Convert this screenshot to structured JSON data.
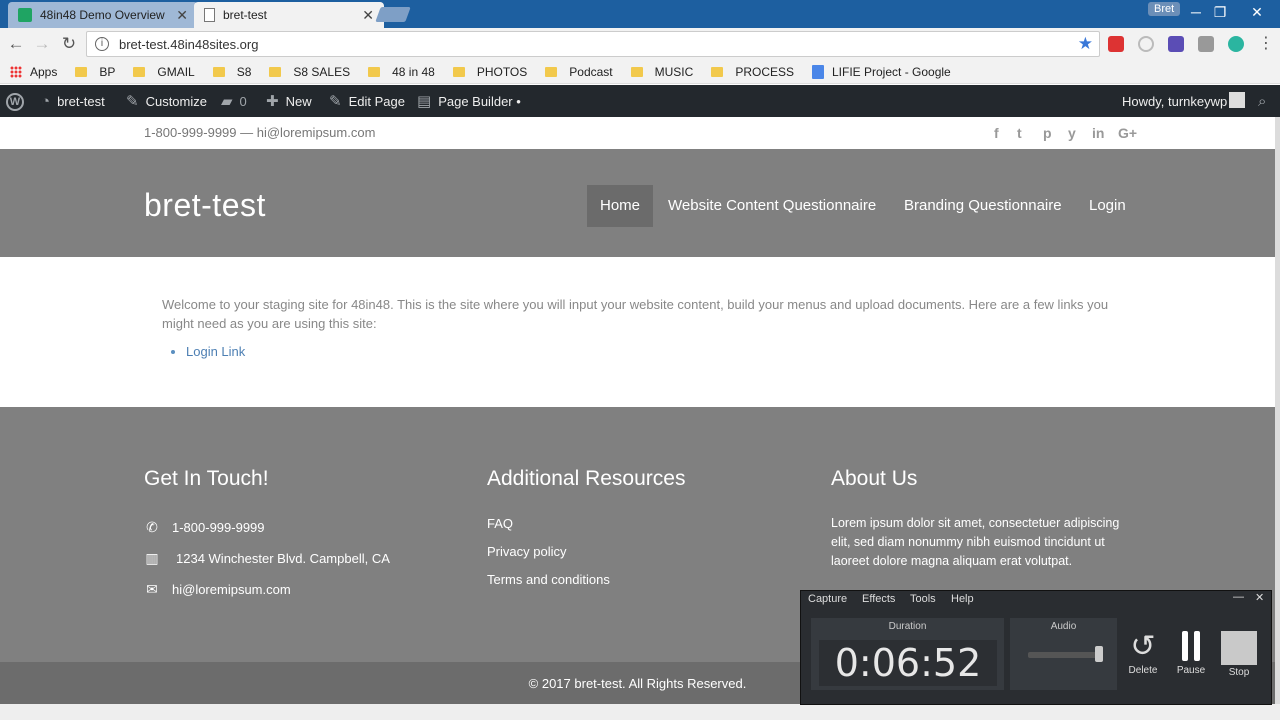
{
  "browser": {
    "tabs": [
      {
        "title": "48in48 Demo Overview",
        "active": false
      },
      {
        "title": "bret-test",
        "active": true
      }
    ],
    "profile": "Bret",
    "url": "bret-test.48in48sites.org",
    "bookmarks": [
      "Apps",
      "BP",
      "GMAIL",
      "S8",
      "S8 SALES",
      "48 in 48",
      "PHOTOS",
      "Podcast",
      "MUSIC",
      "PROCESS",
      "LIFIE Project - Google"
    ]
  },
  "adminbar": {
    "site": "bret-test",
    "customize": "Customize",
    "comments": "0",
    "new": "New",
    "edit": "Edit Page",
    "builder": "Page Builder •",
    "howdy": "Howdy, turnkeywp"
  },
  "topbar": {
    "contact": "1-800-999-9999 — hi@loremipsum.com",
    "social": [
      "f",
      "t",
      "p",
      "y",
      "in",
      "G+"
    ]
  },
  "header": {
    "site_title": "bret-test",
    "nav": [
      "Home",
      "Website Content Questionnaire",
      "Branding Questionnaire",
      "Login"
    ]
  },
  "content": {
    "intro": "Welcome to your staging site for 48in48. This is the site where you will input your website content, build your menus and upload documents. Here are a few links you might need as you are using this site:",
    "link": "Login Link"
  },
  "footer": {
    "col1": {
      "title": "Get In Touch!",
      "phone": "1-800-999-9999",
      "address": "1234 Winchester Blvd. Campbell, CA",
      "email": "hi@loremipsum.com"
    },
    "col2": {
      "title": "Additional Resources",
      "links": [
        "FAQ",
        "Privacy policy",
        "Terms and conditions"
      ]
    },
    "col3": {
      "title": "About Us",
      "text": "Lorem ipsum dolor sit amet, consectetuer adipiscing elit, sed diam nonummy nibh euismod tincidunt ut laoreet dolore magna aliquam erat volutpat."
    },
    "copyright": "© 2017 bret-test. All Rights Reserved."
  },
  "recorder": {
    "menu": [
      "Capture",
      "Effects",
      "Tools",
      "Help"
    ],
    "duration_label": "Duration",
    "duration": "0:06:52",
    "audio_label": "Audio",
    "buttons": [
      "Delete",
      "Pause",
      "Stop"
    ]
  },
  "colors": {
    "admin_bar": "#23282d",
    "header_gray": "#808080",
    "link_blue": "#4d7fb3"
  }
}
